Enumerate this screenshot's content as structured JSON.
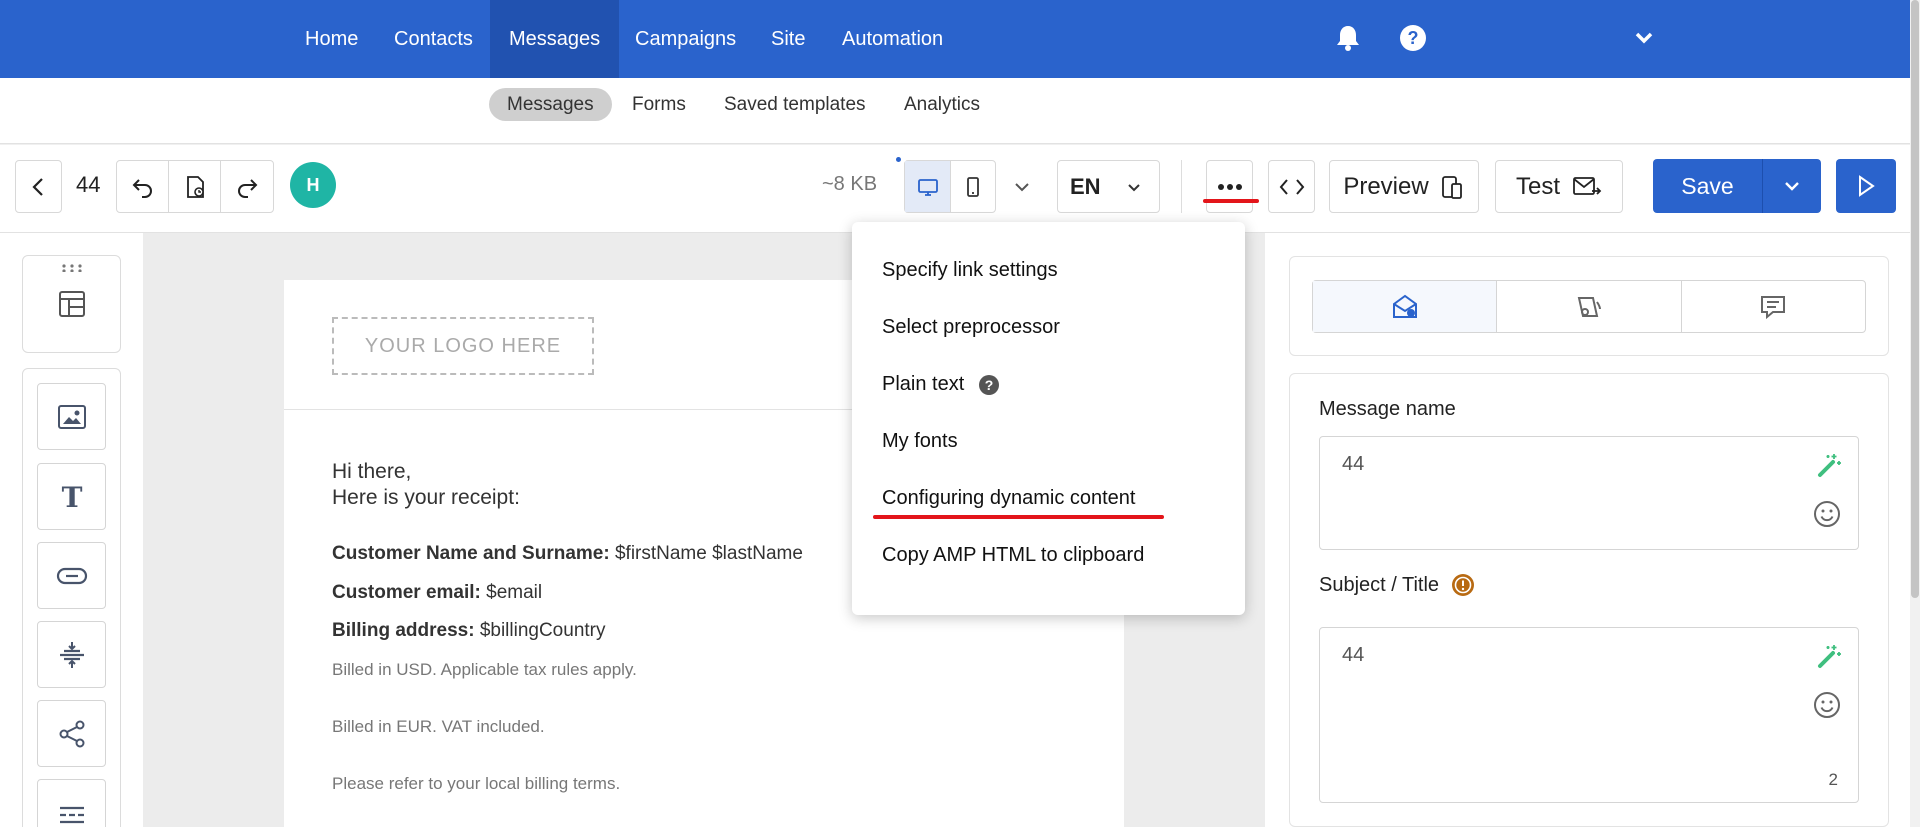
{
  "topnav": {
    "items": [
      {
        "label": "Home"
      },
      {
        "label": "Contacts"
      },
      {
        "label": "Messages",
        "active": true
      },
      {
        "label": "Campaigns"
      },
      {
        "label": "Site"
      },
      {
        "label": "Automation"
      }
    ],
    "icons": [
      "bell-icon",
      "help-icon",
      "chevron-down-icon"
    ]
  },
  "subnav": {
    "tabs": [
      {
        "label": "Messages",
        "active": true
      },
      {
        "label": "Forms"
      },
      {
        "label": "Saved templates"
      },
      {
        "label": "Analytics"
      }
    ]
  },
  "toolbar": {
    "message_id": "44",
    "avatar_initial": "H",
    "size_label": "~8 KB",
    "language": "EN",
    "preview_label": "Preview",
    "test_label": "Test",
    "save_label": "Save"
  },
  "more_menu": {
    "items": [
      {
        "label": "Specify link settings"
      },
      {
        "label": "Select preprocessor"
      },
      {
        "label": "Plain text",
        "has_help": true
      },
      {
        "label": "My fonts"
      },
      {
        "label": "Configuring dynamic content",
        "highlighted": true
      },
      {
        "label": "Copy AMP HTML to clipboard"
      }
    ]
  },
  "email": {
    "logo_placeholder": "YOUR LOGO HERE",
    "greeting_line1": "Hi there,",
    "greeting_line2": "Here is your receipt:",
    "customer_name_label": "Customer Name and Surname:",
    "customer_name_value": "$firstName $lastName",
    "customer_email_label": "Customer email:",
    "customer_email_value": "$email",
    "billing_label": "Billing address:",
    "billing_value": "$billingCountry",
    "note_usd": "Billed in USD. Applicable tax rules apply.",
    "note_eur": "Billed in EUR. VAT included.",
    "note_local": "Please refer to your local billing terms."
  },
  "rightpanel": {
    "message_name_label": "Message name",
    "message_name_value": "44",
    "subject_label": "Subject / Title",
    "subject_value": "44",
    "subject_count": "2"
  },
  "colors": {
    "brand_blue": "#2a63cc",
    "avatar_teal": "#1fb5a5",
    "warning_orange": "#b86a12",
    "annotation_red": "#e3151a",
    "magic_green": "#3fbf7f"
  }
}
